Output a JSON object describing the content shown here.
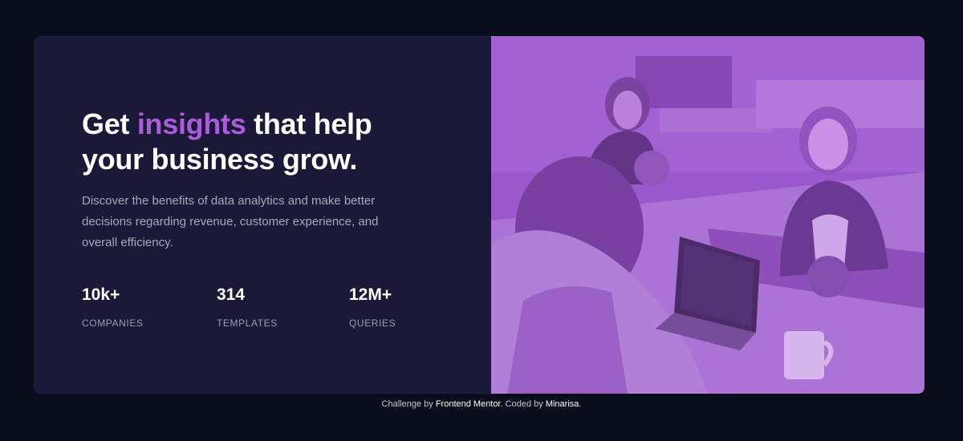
{
  "hero": {
    "headline_before": "Get ",
    "headline_accent": "insights",
    "headline_after": " that help your business grow.",
    "description": "Discover the benefits of data analytics and make better decisions regarding revenue, customer experience, and overall efficiency.",
    "accent_color": "#aa5cdb",
    "image_tint_color": "#9a56cc"
  },
  "stats": [
    {
      "value": "10k+",
      "label": "COMPANIES"
    },
    {
      "value": "314",
      "label": "TEMPLATES"
    },
    {
      "value": "12M+",
      "label": "QUERIES"
    }
  ],
  "attribution": {
    "prefix": "Challenge by ",
    "link1": "Frontend Mentor",
    "middle": ". Coded by ",
    "link2": "Minarisa",
    "suffix": "."
  }
}
